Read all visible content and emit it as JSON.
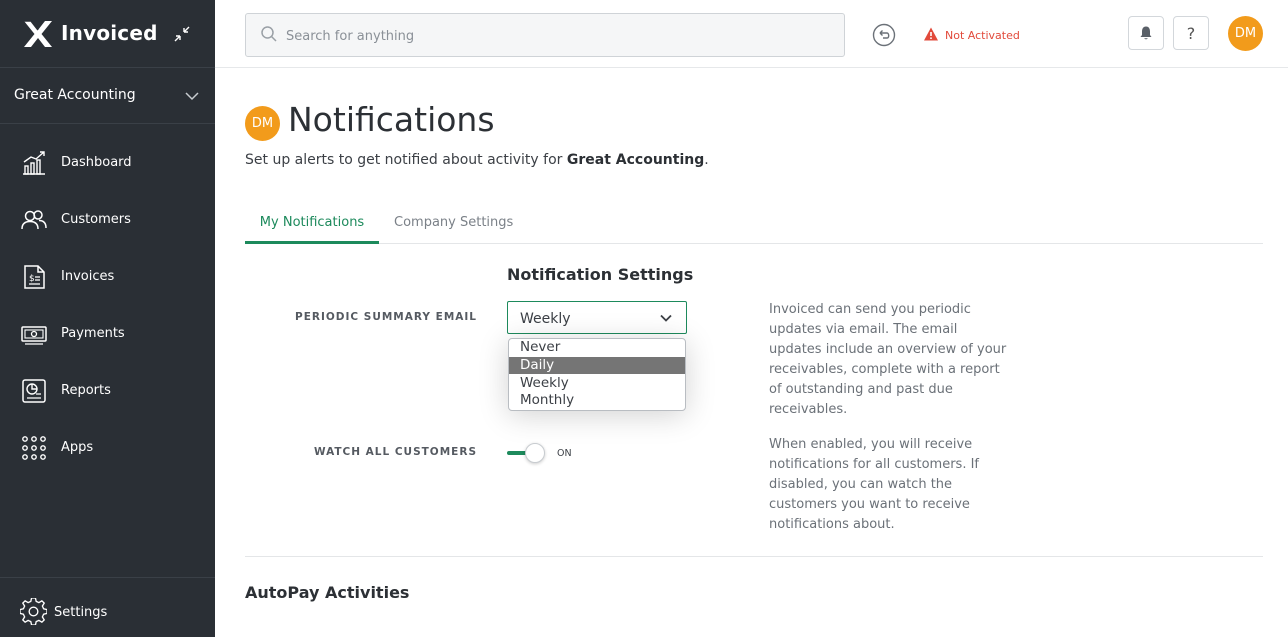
{
  "brand": {
    "name": "Invoiced"
  },
  "sidebar": {
    "company": "Great Accounting",
    "items": [
      {
        "label": "Dashboard",
        "icon": "dashboard-icon"
      },
      {
        "label": "Customers",
        "icon": "customers-icon"
      },
      {
        "label": "Invoices",
        "icon": "invoices-icon"
      },
      {
        "label": "Payments",
        "icon": "payments-icon"
      },
      {
        "label": "Reports",
        "icon": "reports-icon"
      },
      {
        "label": "Apps",
        "icon": "apps-icon"
      }
    ],
    "settings": "Settings"
  },
  "topbar": {
    "search_placeholder": "Search for anything",
    "status": "Not Activated",
    "help": "?",
    "avatar_initials": "DM"
  },
  "page": {
    "avatar_initials": "DM",
    "title": "Notifications",
    "subtitle_prefix": "Set up alerts to get notified about activity for ",
    "subtitle_company": "Great Accounting",
    "subtitle_suffix": ".",
    "tabs": [
      {
        "label": "My Notifications",
        "active": true
      },
      {
        "label": "Company Settings",
        "active": false
      }
    ],
    "section_title": "Notification Settings",
    "periodic": {
      "label": "PERIODIC SUMMARY EMAIL",
      "value": "Weekly",
      "options": [
        "Never",
        "Daily",
        "Weekly",
        "Monthly"
      ],
      "highlighted": "Daily",
      "help": "Invoiced can send you periodic updates via email. The email updates include an overview of your receivables, complete with a report of outstanding and past due receivables."
    },
    "watch": {
      "label": "WATCH ALL CUSTOMERS",
      "state": "ON",
      "help": "When enabled, you will receive notifications for all customers. If disabled, you can watch the customers you want to receive notifications about."
    },
    "next_section": "AutoPay Activities"
  },
  "colors": {
    "sidebar_bg": "#2a2f35",
    "accent": "#1d8a5c",
    "avatar": "#f29b1b",
    "warning": "#e24a3b"
  }
}
